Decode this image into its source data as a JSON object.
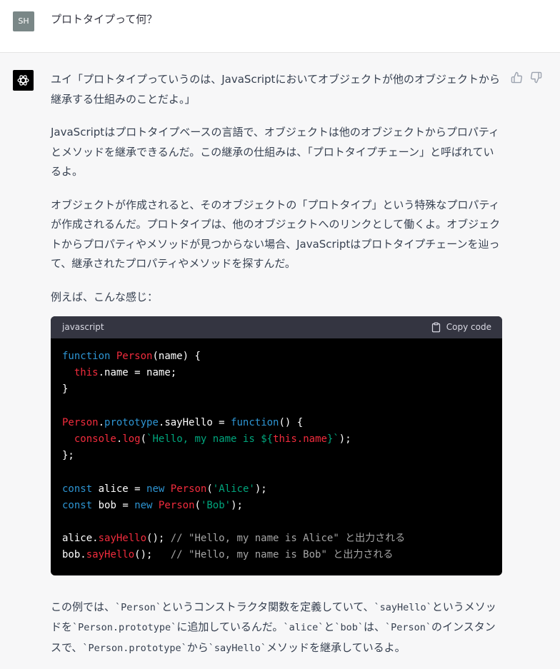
{
  "user": {
    "avatar_initials": "SH",
    "message": "プロトタイプって何？"
  },
  "assistant": {
    "paragraphs": [
      "ユイ「プロトタイプっていうのは、JavaScriptにおいてオブジェクトが他のオブジェクトから継承する仕組みのことだよ。」",
      "JavaScriptはプロトタイプベースの言語で、オブジェクトは他のオブジェクトからプロパティとメソッドを継承できるんだ。この継承の仕組みは、「プロトタイプチェーン」と呼ばれているよ。",
      "オブジェクトが作成されると、そのオブジェクトの「プロトタイプ」という特殊なプロパティが作成されるんだ。プロトタイプは、他のオブジェクトへのリンクとして働くよ。オブジェクトからプロパティやメソッドが見つからない場合、JavaScriptはプロトタイプチェーンを辿って、継承されたプロパティやメソッドを探すんだ。",
      "例えば、こんな感じ："
    ],
    "code_block": {
      "language": "javascript",
      "copy_label": "Copy code",
      "tokens": {
        "function": "function",
        "Person": "Person",
        "name_param": "name",
        "this": "this",
        "name": "name",
        "prototype": "prototype",
        "sayHello": "sayHello",
        "console": "console",
        "log": "log",
        "template_start": "`Hello, my name is ${",
        "this_name": "this.name",
        "template_end": "}`",
        "const": "const",
        "alice": "alice",
        "bob": "bob",
        "new": "new",
        "alice_str": "'Alice'",
        "bob_str": "'Bob'",
        "comment_alice": "// \"Hello, my name is Alice\" と出力される",
        "comment_bob": "// \"Hello, my name is Bob\" と出力される"
      }
    },
    "final": {
      "t1": "この例では、",
      "c1": "`Person`",
      "t2": "というコンストラクタ関数を定義していて、",
      "c2": "`sayHello`",
      "t3": "というメソッドを",
      "c3": "`Person.prototype`",
      "t4": "に追加しているんだ。",
      "c4": "`alice`",
      "t5": "と",
      "c5": "`bob`",
      "t6": "は、",
      "c6": "`Person`",
      "t7": "のインスタンスで、",
      "c7": "`Person.prototype`",
      "t8": "から",
      "c8": "`sayHello`",
      "t9": "メソッドを継承しているよ。"
    }
  },
  "icons": {
    "thumbs_up": "thumbs-up-icon",
    "thumbs_down": "thumbs-down-icon",
    "clipboard": "clipboard-icon",
    "openai": "openai-logo-icon"
  }
}
